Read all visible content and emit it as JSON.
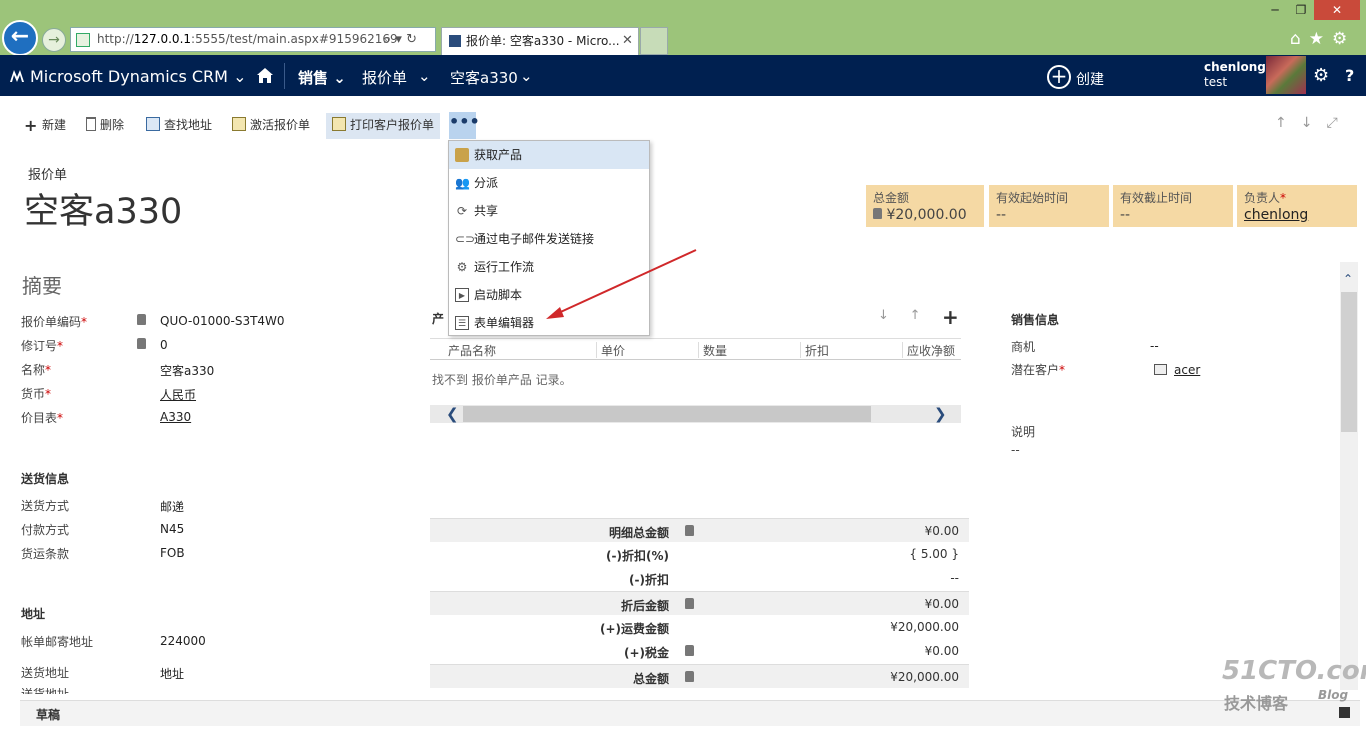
{
  "browser": {
    "url_prefix": "http://",
    "url_domain": "127.0.0.1",
    "url_rest": ":5555/test/main.aspx#915962169",
    "tab_title": "报价单: 空客a330 - Micro...",
    "tab_close": "✕",
    "minimize": "─",
    "restore": "❐",
    "close": "✕",
    "icons": "⌂★⚙"
  },
  "nav": {
    "app_name": "Microsoft Dynamics CRM ⌄",
    "sales": "销售 ⌄",
    "entity": "报价单",
    "entity_chevron": "⌄",
    "record": "空客a330",
    "record_chevron": "⌄",
    "create": "创建",
    "user_name": "chenlong",
    "org": "test"
  },
  "commands": {
    "new": "新建",
    "delete": "删除",
    "find_address": "查找地址",
    "activate": "激活报价单",
    "print": "打印客户报价单",
    "more": "•••"
  },
  "menu": {
    "items": [
      "获取产品",
      "分派",
      "共享",
      "通过电子邮件发送链接",
      "运行工作流",
      "启动脚本",
      "表单编辑器"
    ]
  },
  "header": {
    "entity_label": "报价单",
    "record_title": "空客a330",
    "tiles": [
      {
        "label": "总金额",
        "value": "¥20,000.00"
      },
      {
        "label": "有效起始时间",
        "value": "--"
      },
      {
        "label": "有效截止时间",
        "value": "--"
      },
      {
        "label": "负责人",
        "value": "chenlong"
      }
    ]
  },
  "summary": {
    "title": "摘要",
    "fields": [
      {
        "label": "报价单编码",
        "value": "QUO-01000-S3T4W0"
      },
      {
        "label": "修订号",
        "value": "0"
      },
      {
        "label": "名称",
        "value": "空客a330"
      },
      {
        "label": "货币",
        "value": "人民币"
      },
      {
        "label": "价目表",
        "value": "A330"
      }
    ]
  },
  "shipping": {
    "title": "送货信息",
    "fields": [
      {
        "label": "送货方式",
        "value": "邮递"
      },
      {
        "label": "付款方式",
        "value": "N45"
      },
      {
        "label": "货运条款",
        "value": "FOB"
      }
    ]
  },
  "address": {
    "title": "地址",
    "fields": [
      {
        "label": "帐单邮寄地址",
        "value": "224000"
      },
      {
        "label": "送货地址",
        "value": "地址"
      }
    ],
    "cut_label": "送货地址"
  },
  "products": {
    "title": "产",
    "columns": [
      "产品名称",
      "单价",
      "数量",
      "折扣",
      "应收净额"
    ],
    "empty": "找不到 报价单产品 记录。"
  },
  "totals": [
    {
      "label": "明细总金额",
      "value": "¥0.00"
    },
    {
      "label": "(-)折扣(%)",
      "value": "{ 5.00 }"
    },
    {
      "label": "(-)折扣",
      "value": "--"
    },
    {
      "label": "折后金额",
      "value": "¥0.00"
    },
    {
      "label": "(+)运费金额",
      "value": "¥20,000.00"
    },
    {
      "label": "(+)税金",
      "value": "¥0.00"
    },
    {
      "label": "总金额",
      "value": "¥20,000.00"
    }
  ],
  "sales_info": {
    "title": "销售信息",
    "opportunity_label": "商机",
    "opportunity_value": "--",
    "customer_label": "潜在客户",
    "customer_value": "acer",
    "description_label": "说明",
    "description_value": "--"
  },
  "footer": {
    "status": "草稿"
  },
  "watermark": {
    "line1": "51CTO.com",
    "line2": "技术博客",
    "line3": "Blog"
  }
}
